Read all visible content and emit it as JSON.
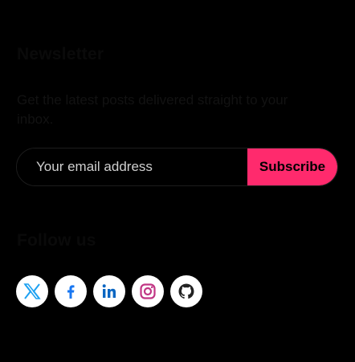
{
  "newsletter": {
    "title": "Newsletter",
    "description": "Get the latest posts delivered straight to your inbox.",
    "email_placeholder": "Your email address",
    "subscribe_label": "Subscribe"
  },
  "follow": {
    "title": "Follow us",
    "socials": [
      {
        "icon": "x-twitter-icon",
        "color": "#1da1f2"
      },
      {
        "icon": "facebook-icon",
        "color": "#1877f2"
      },
      {
        "icon": "linkedin-icon",
        "color": "#0a66c2"
      },
      {
        "icon": "instagram-icon",
        "color": "#c13584"
      },
      {
        "icon": "github-icon",
        "color": "#222222"
      }
    ]
  },
  "colors": {
    "background": "#000000",
    "accent": "#ff2a6d",
    "icon_circle": "#ffffff"
  }
}
